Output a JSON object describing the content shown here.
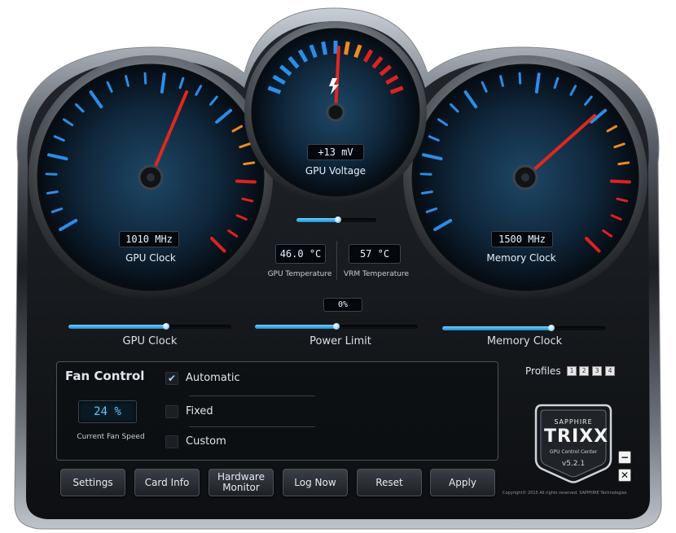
{
  "gauges": {
    "gpu_clock": {
      "readout": "1010 MHz",
      "label": "GPU Clock",
      "level": 0.56
    },
    "gpu_voltage": {
      "readout": "+13 mV",
      "label": "GPU Voltage",
      "level": 0.52
    },
    "memory_clock": {
      "readout": "1500 MHz",
      "label": "Memory Clock",
      "level": 0.66
    }
  },
  "temperatures": {
    "gpu": {
      "value": "46.0 °C",
      "label": "GPU Temperature"
    },
    "vrm": {
      "value": "57 °C",
      "label": "VRM Temperature"
    }
  },
  "power_percent": "0%",
  "sliders": {
    "voltage": {
      "fill": 0.52
    },
    "gpu_clock": {
      "label": "GPU Clock",
      "fill": 0.6
    },
    "power_limit": {
      "label": "Power Limit",
      "fill": 0.5
    },
    "memory_clock": {
      "label": "Memory Clock",
      "fill": 0.67
    }
  },
  "fan_control": {
    "title": "Fan Control",
    "speed": "24 %",
    "speed_label": "Current Fan Speed",
    "options": [
      {
        "label": "Automatic",
        "checked": true
      },
      {
        "label": "Fixed",
        "checked": false
      },
      {
        "label": "Custom",
        "checked": false
      }
    ]
  },
  "profiles": {
    "label": "Profiles",
    "items": [
      "1",
      "2",
      "3",
      "4"
    ]
  },
  "buttons": {
    "settings": "Settings",
    "card_info": "Card Info",
    "hardware_monitor": "Hardware Monitor",
    "log_now": "Log Now",
    "reset": "Reset",
    "apply": "Apply"
  },
  "logo": {
    "brand": "SAPPHIRE",
    "product": "TRIXX",
    "subtitle": "GPU Control Center",
    "version": "v5.2.1"
  },
  "copyright": "Copyright© 2015 All rights reserved. SAPPHIRE Technologies",
  "window": {
    "minimize": "−",
    "close": "✕"
  },
  "colors": {
    "accent_blue": "#2a8ee8",
    "warn_orange": "#f08a20",
    "danger_red": "#e02020",
    "face_dark": "#0c1e30"
  }
}
